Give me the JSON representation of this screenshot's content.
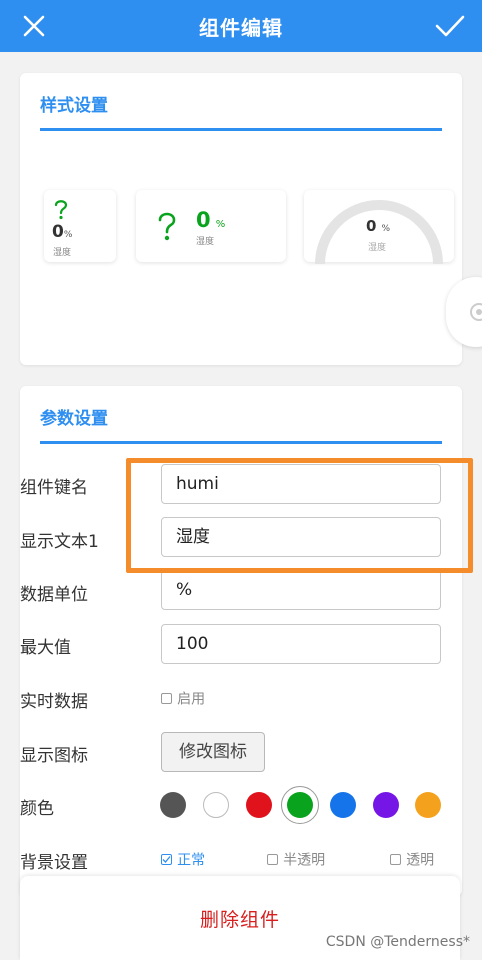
{
  "header": {
    "title": "组件编辑",
    "close_icon": "close-icon",
    "confirm_icon": "check-icon"
  },
  "style_section": {
    "title": "样式设置",
    "previews": [
      {
        "value": "0",
        "unit": "%",
        "label": "湿度",
        "icon": "question-mark-icon"
      },
      {
        "value": "0",
        "unit": "%",
        "label": "湿度",
        "icon": "question-mark-icon"
      },
      {
        "value": "0",
        "unit": "%",
        "label": "湿度",
        "icon": "gauge-arc-icon"
      }
    ]
  },
  "params_section": {
    "title": "参数设置",
    "fields": {
      "key_name": {
        "label": "组件键名",
        "value": "humi"
      },
      "display_text": {
        "label": "显示文本1",
        "value": "湿度"
      },
      "unit": {
        "label": "数据单位",
        "value": "%"
      },
      "max": {
        "label": "最大值",
        "value": "100"
      }
    },
    "realtime": {
      "label": "实时数据",
      "option": "启用",
      "checked": false
    },
    "icon": {
      "label": "显示图标",
      "button": "修改图标"
    },
    "color": {
      "label": "颜色",
      "swatches": [
        "#555555",
        "#ffffff",
        "#e0121b",
        "#0aa31d",
        "#1574ea",
        "#7515e6",
        "#f4a21e"
      ],
      "selected_index": 3
    },
    "background": {
      "label": "背景设置",
      "options": [
        {
          "text": "正常",
          "checked": true
        },
        {
          "text": "半透明",
          "checked": false
        },
        {
          "text": "透明",
          "checked": false
        }
      ]
    }
  },
  "footer": {
    "delete_label": "删除组件"
  },
  "watermark": "CSDN @Tenderness*",
  "colors": {
    "primary": "#2f8ff0",
    "highlight": "#f58c2c",
    "danger": "#d81e1e",
    "icon_green": "#0aa31d"
  }
}
